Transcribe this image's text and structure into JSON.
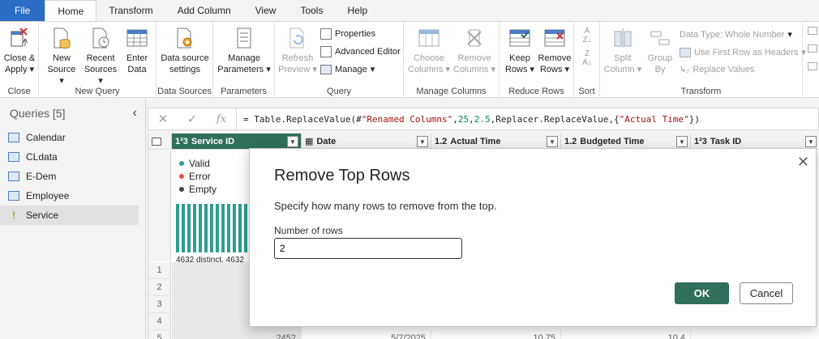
{
  "tabs": [
    "File",
    "Home",
    "Transform",
    "Add Column",
    "View",
    "Tools",
    "Help"
  ],
  "ribbon": {
    "close": {
      "btn": [
        "Close &",
        "Apply"
      ],
      "label": "Close"
    },
    "new_query": {
      "new_source": [
        "New",
        "Source"
      ],
      "recent_sources": [
        "Recent",
        "Sources"
      ],
      "enter_data": [
        "Enter",
        "Data"
      ],
      "label": "New Query"
    },
    "data_sources": {
      "btn": [
        "Data source",
        "settings"
      ],
      "label": "Data Sources"
    },
    "parameters": {
      "btn": [
        "Manage",
        "Parameters"
      ],
      "label": "Parameters"
    },
    "query": {
      "refresh": [
        "Refresh",
        "Preview"
      ],
      "properties": "Properties",
      "advanced_editor": "Advanced Editor",
      "manage": "Manage",
      "label": "Query"
    },
    "manage_columns": {
      "choose": [
        "Choose",
        "Columns"
      ],
      "remove": [
        "Remove",
        "Columns"
      ],
      "label": "Manage Columns"
    },
    "reduce_rows": {
      "keep": [
        "Keep",
        "Rows"
      ],
      "remove": [
        "Remove",
        "Rows"
      ],
      "label": "Reduce Rows"
    },
    "sort": {
      "label": "Sort"
    },
    "transform": {
      "split": [
        "Split",
        "Column"
      ],
      "group": [
        "Group",
        "By"
      ],
      "data_type": "Data Type: Whole Number",
      "first_row": "Use First Row as Headers",
      "replace": "Replace Values",
      "label": "Transform"
    }
  },
  "queries": {
    "header": "Queries [5]",
    "items": [
      "Calendar",
      "CLdata",
      "E-Dem",
      "Employee",
      "Service"
    ]
  },
  "formula": {
    "prefix": "= Table.ReplaceValue(#",
    "s1": "\"Renamed Columns\"",
    "c1": ",",
    "n1": "25",
    "c2": ",",
    "n2": "2.5",
    "mid": ",Replacer.ReplaceValue,{",
    "s2": "\"Actual Time\"",
    "end": "})"
  },
  "columns": [
    {
      "type": "1²3",
      "name": "Service ID"
    },
    {
      "type": "▦",
      "name": "Date"
    },
    {
      "type": "1.2",
      "name": "Actual Time"
    },
    {
      "type": "1.2",
      "name": "Budgeted Time"
    },
    {
      "type": "1²3",
      "name": "Task ID"
    }
  ],
  "quality": {
    "valid": "Valid",
    "error": "Error",
    "empty": "Empty",
    "distinct": "4632 distinct, 4632"
  },
  "rows": [
    "1",
    "2",
    "3",
    "4",
    "5"
  ],
  "row5": {
    "service": "2452",
    "date": "5/7/2025",
    "actual": "10.75",
    "budget": "10.4"
  },
  "colors": {
    "accent": "#2f6f5c",
    "file_tab": "#2b6cc4",
    "valid": "#2f9e8f",
    "error": "#e0533f",
    "empty": "#444444"
  },
  "dialog": {
    "title": "Remove Top Rows",
    "description": "Specify how many rows to remove from the top.",
    "field_label": "Number of rows",
    "field_value": "2",
    "ok": "OK",
    "cancel": "Cancel"
  }
}
